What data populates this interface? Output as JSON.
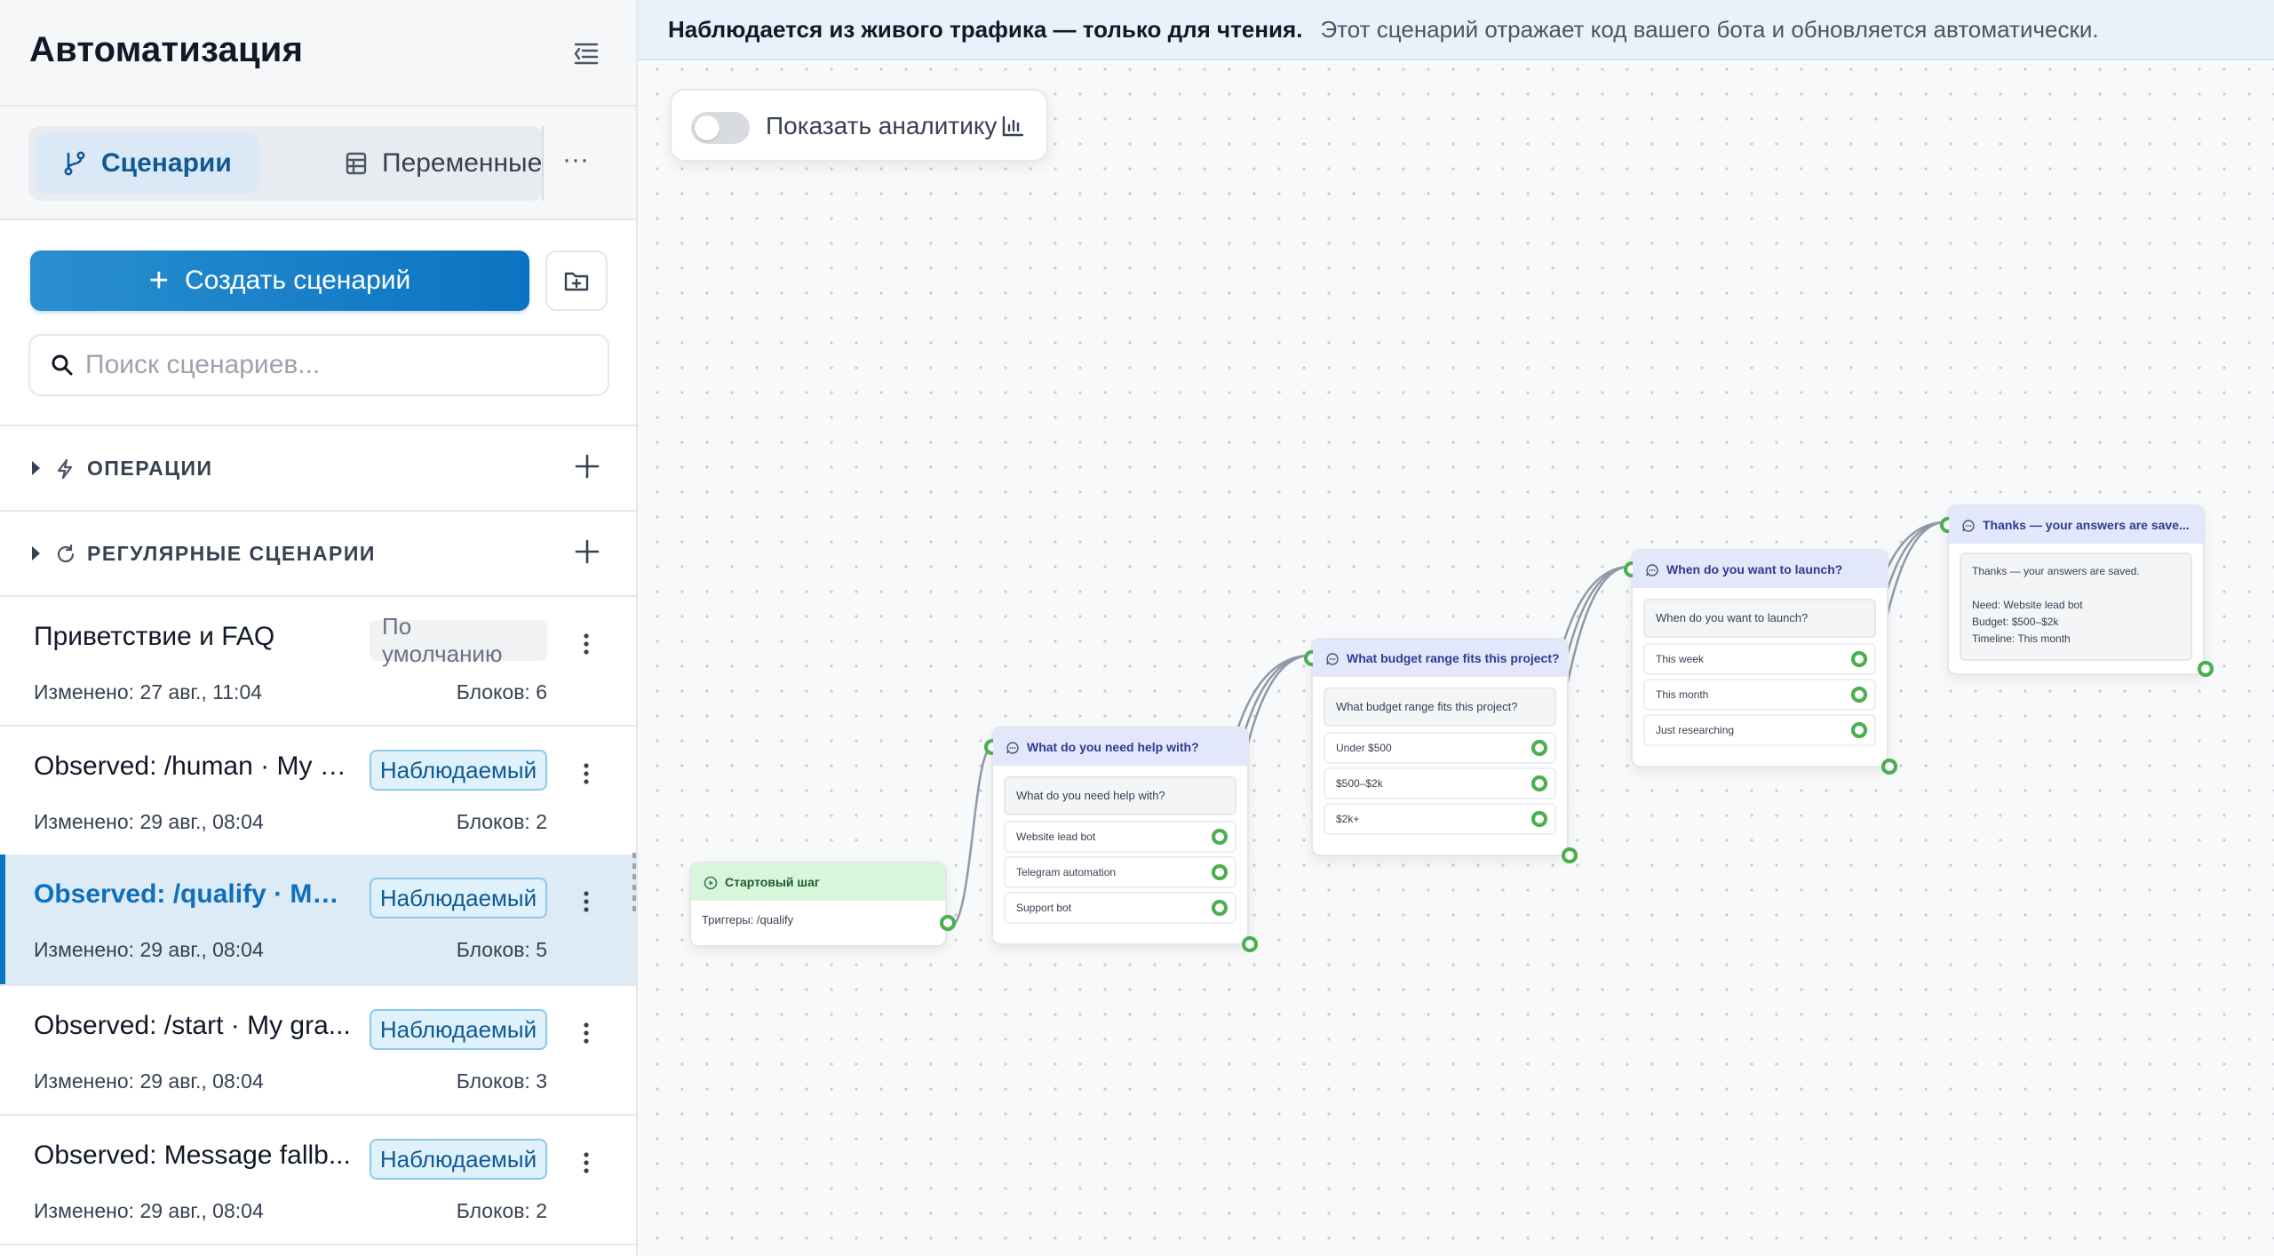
{
  "sidebar": {
    "title": "Автоматизация",
    "tabs": [
      {
        "label": "Сценарии",
        "active": true
      },
      {
        "label": "Переменные",
        "active": false
      }
    ],
    "more": "···",
    "create_button": "Создать сценарий",
    "search_placeholder": "Поиск сценариев...",
    "sections": [
      {
        "label": "ОПЕРАЦИИ"
      },
      {
        "label": "РЕГУЛЯРНЫЕ СЦЕНАРИИ"
      }
    ],
    "scenarios": [
      {
        "name": "Приветствие и FAQ",
        "badge": "По умолчанию",
        "modified": "Изменено: 27 авг., 11:04",
        "blocks": "Блоков: 6"
      },
      {
        "name": "Observed: /human · My g...",
        "badge": "Наблюдаемый",
        "modified": "Изменено: 29 авг., 08:04",
        "blocks": "Блоков: 2"
      },
      {
        "name": "Observed: /qualify · My ...",
        "badge": "Наблюдаемый",
        "modified": "Изменено: 29 авг., 08:04",
        "blocks": "Блоков: 5",
        "active": true
      },
      {
        "name": "Observed: /start · My gra...",
        "badge": "Наблюдаемый",
        "modified": "Изменено: 29 авг., 08:04",
        "blocks": "Блоков: 3"
      },
      {
        "name": "Observed: Message fallb...",
        "badge": "Наблюдаемый",
        "modified": "Изменено: 29 авг., 08:04",
        "blocks": "Блоков: 2"
      }
    ]
  },
  "canvas": {
    "banner_bold": "Наблюдается из живого трафика — только для чтения.",
    "banner_rest": "Этот сценарий отражает код вашего бота и обновляется автоматически.",
    "analytics_label": "Показать аналитику",
    "analytics_on": false,
    "nodes": {
      "start": {
        "title": "Стартовый шаг",
        "trigger": "Триггеры: /qualify"
      },
      "help": {
        "title": "What do you need help with?",
        "question": "What do you need help with?",
        "options": [
          "Website lead bot",
          "Telegram automation",
          "Support bot"
        ]
      },
      "budget": {
        "title": "What budget range fits this project?",
        "question": "What budget range fits this project?",
        "options": [
          "Under $500",
          "$500–$2k",
          "$2k+"
        ]
      },
      "launch": {
        "title": "When do you want to launch?",
        "question": "When do you want to launch?",
        "options": [
          "This week",
          "This month",
          "Just researching"
        ]
      },
      "thanks": {
        "title": "Thanks — your answers are save...",
        "lines": [
          "Thanks — your answers are saved.",
          "",
          "Need: Website lead bot",
          "Budget: $500–$2k",
          "Timeline: This month"
        ]
      }
    }
  },
  "colors": {
    "accent": "#0b74c2",
    "port": "#4caf50",
    "edge": "#8a94a6",
    "observed_badge_bg": "#dff1fb"
  },
  "icons": {
    "collapse": "sidebar-collapse-icon",
    "scenarios_tab": "branch-icon",
    "variables_tab": "table-icon",
    "folder": "folder-plus-icon",
    "search": "search-icon",
    "operations": "bolt-icon",
    "scheduled": "refresh-icon",
    "analytics": "bar-chart-icon",
    "message": "message-icon",
    "start": "play-circle-icon"
  }
}
